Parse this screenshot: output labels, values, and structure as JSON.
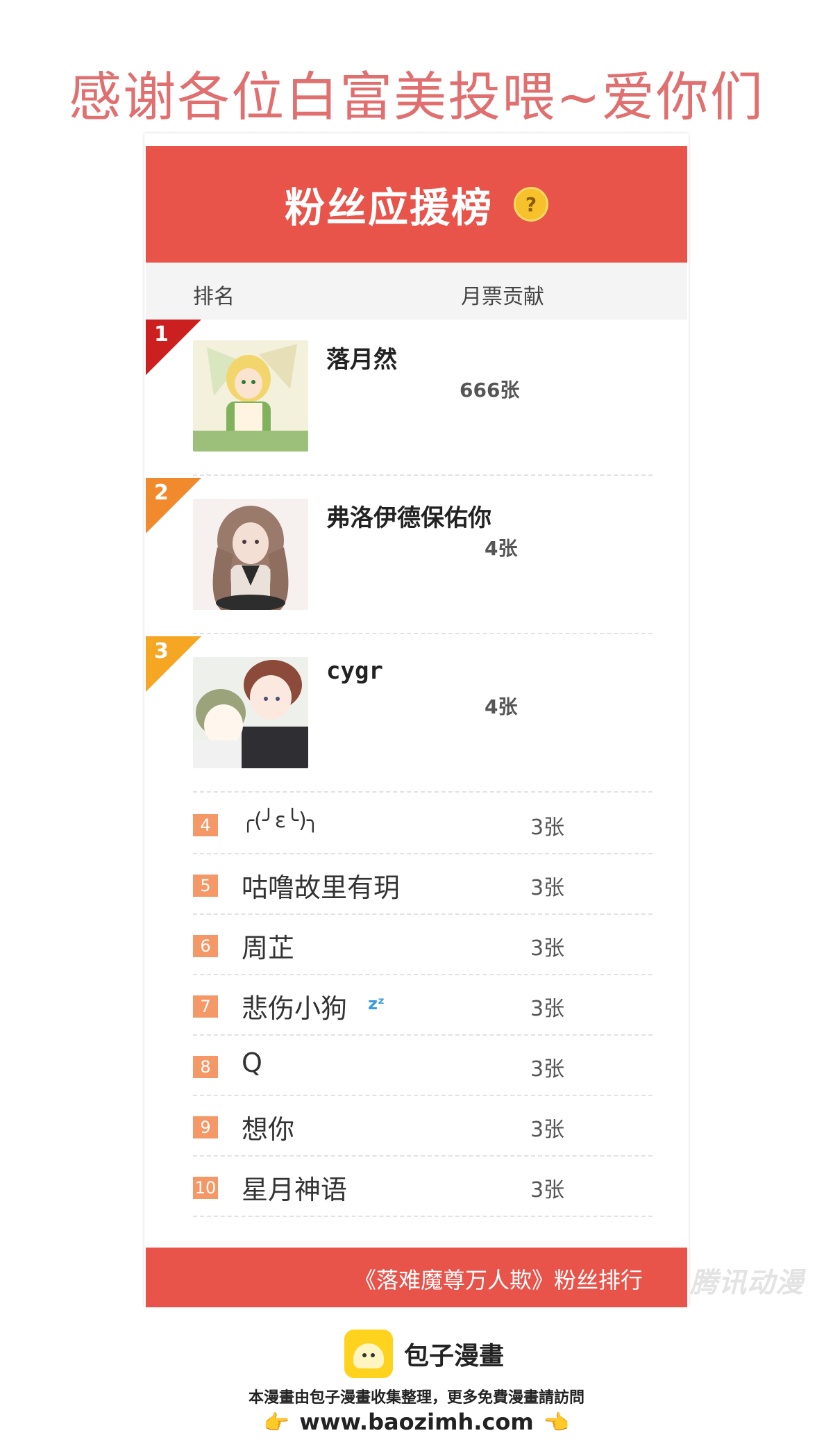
{
  "banner": "感谢各位白富美投喂~爱你们",
  "card": {
    "title": "粉丝应援榜",
    "help": "?",
    "col_rank": "排名",
    "col_votes": "月票贡献"
  },
  "top": [
    {
      "rank": "1",
      "name": "落月然",
      "votes": "666张",
      "color": "#cc1f1f"
    },
    {
      "rank": "2",
      "name": "弗洛伊德保佑你",
      "votes": "4张",
      "color": "#f08a2c"
    },
    {
      "rank": "3",
      "name": "cygr",
      "votes": "4张",
      "color": "#f5a623"
    }
  ],
  "rows": [
    {
      "rank": "4",
      "name": "╭(╯ε╰)╮",
      "votes": "3张"
    },
    {
      "rank": "5",
      "name": "咕噜故里有玥",
      "votes": "3张"
    },
    {
      "rank": "6",
      "name": "周芷",
      "votes": "3张"
    },
    {
      "rank": "7",
      "name": "悲伤小狗",
      "votes": "3张"
    },
    {
      "rank": "8",
      "name": "Q",
      "votes": "3张"
    },
    {
      "rank": "9",
      "name": "想你",
      "votes": "3张"
    },
    {
      "rank": "10",
      "name": "星月神语",
      "votes": "3张"
    }
  ],
  "footer": "《落难魔尊万人欺》粉丝排行",
  "watermark": "腾讯动漫",
  "brand": {
    "name": "包子漫畫",
    "credit": "本漫畫由包子漫畫收集整理，更多免費漫畫請訪問",
    "url": "www.baozimh.com"
  }
}
